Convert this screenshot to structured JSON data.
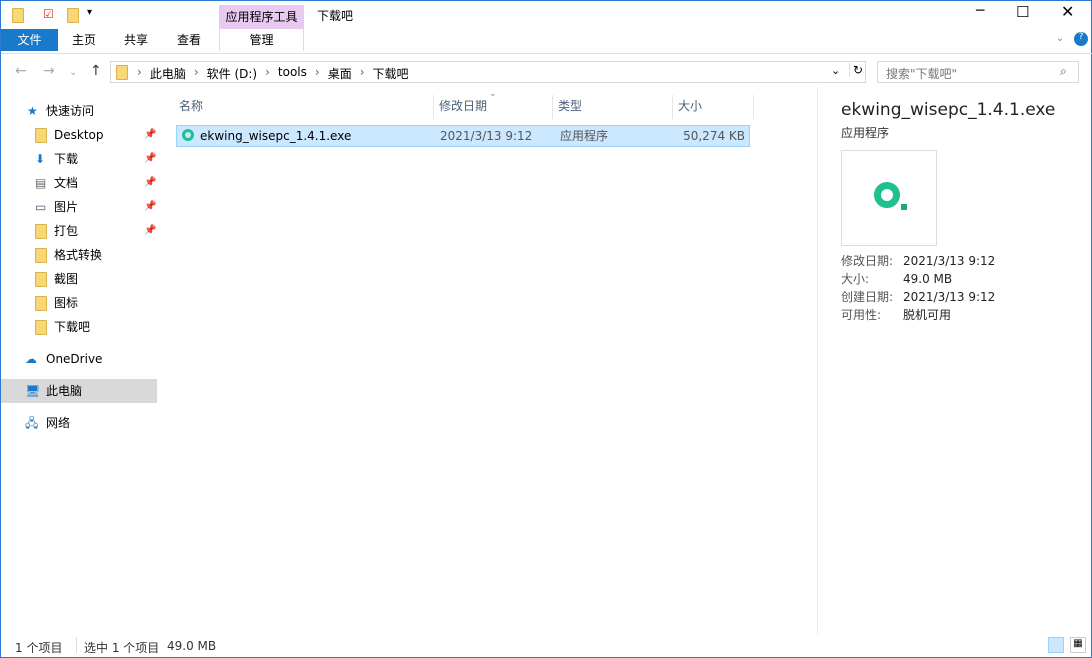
{
  "titlebar": {
    "contextual_tab": "应用程序工具",
    "title": "下载吧"
  },
  "ribbon": {
    "tabs": [
      "文件",
      "主页",
      "共享",
      "查看",
      "管理"
    ]
  },
  "address": {
    "crumbs": [
      "此电脑",
      "软件 (D:)",
      "tools",
      "桌面",
      "下载吧"
    ],
    "search_placeholder": "搜索\"下载吧\""
  },
  "sidebar": {
    "quick_access": "快速访问",
    "items": [
      "Desktop",
      "下载",
      "文档",
      "图片",
      "打包",
      "格式转换",
      "截图",
      "图标",
      "下载吧"
    ],
    "onedrive": "OneDrive",
    "this_pc": "此电脑",
    "network": "网络"
  },
  "columns": [
    "名称",
    "修改日期",
    "类型",
    "大小"
  ],
  "files": [
    {
      "name": "ekwing_wisepc_1.4.1.exe",
      "modified": "2021/3/13 9:12",
      "type": "应用程序",
      "size": "50,274 KB"
    }
  ],
  "details": {
    "name": "ekwing_wisepc_1.4.1.exe",
    "type": "应用程序",
    "rows": [
      {
        "label": "修改日期:",
        "value": "2021/3/13 9:12"
      },
      {
        "label": "大小:",
        "value": "49.0 MB"
      },
      {
        "label": "创建日期:",
        "value": "2021/3/13 9:12"
      },
      {
        "label": "可用性:",
        "value": "脱机可用"
      }
    ]
  },
  "status": {
    "count": "1 个项目",
    "selected": "选中 1 个项目",
    "size": "49.0 MB"
  },
  "colors": {
    "accent": "#1979ca",
    "selection": "#cce8ff",
    "contextual": "#e8c9f0",
    "icon": "#1ec08e"
  }
}
